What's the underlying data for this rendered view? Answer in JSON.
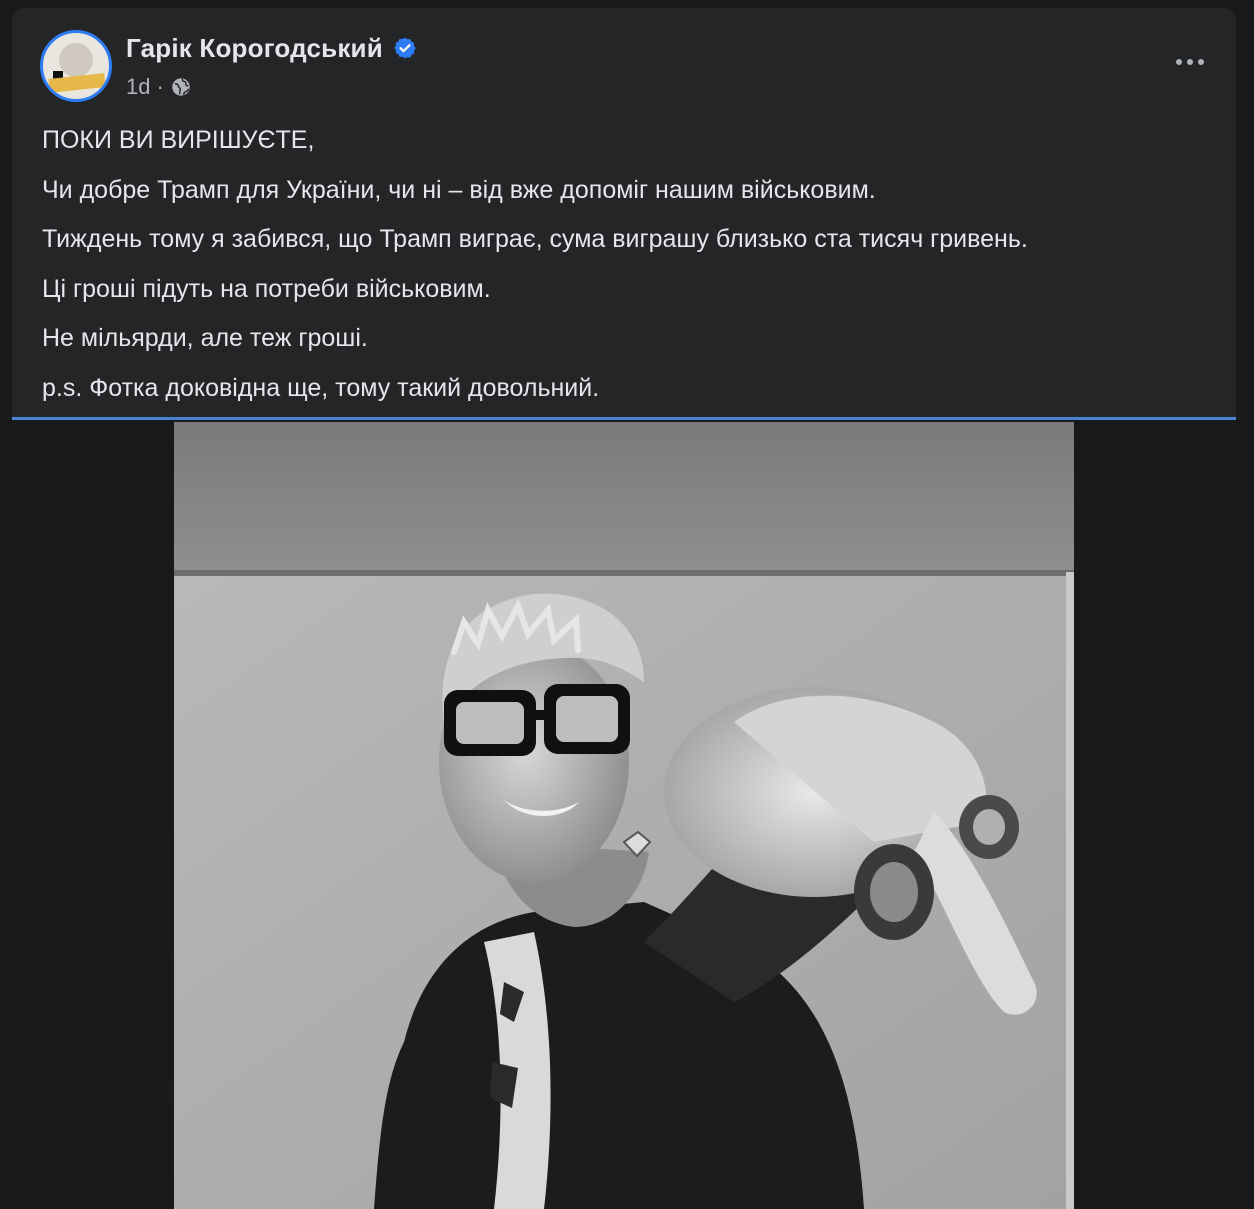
{
  "post": {
    "author": "Гарік Корогодський",
    "verified": true,
    "time": "1d",
    "separator": "·",
    "audience_icon": "globe-icon",
    "more_icon": "more-options-icon",
    "lines": [
      "ПОКИ ВИ ВИРІШУЄТЕ,",
      "Чи добре Трамп для України, чи ні – від вже допоміг нашим військовим.",
      "Тиждень тому я забився, що Трамп виграє, сума виграшу близько ста тисяч гривень.",
      "Ці гроші підуть на потреби військовим.",
      "Не мільярди, але теж гроші.",
      "p.s. Фотка доковідна ще, тому такий довольний."
    ]
  },
  "colors": {
    "page_bg": "#18191a",
    "card_bg": "#242526",
    "text": "#e4e6eb",
    "secondary_text": "#b0b3b8",
    "accent": "#2d7cf6"
  }
}
